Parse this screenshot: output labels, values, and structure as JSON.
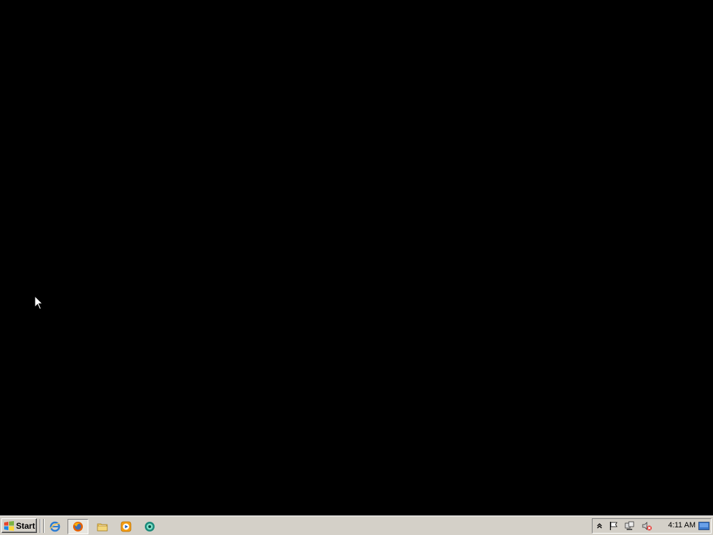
{
  "taskbar": {
    "start_label": "Start",
    "quick_launch": [
      {
        "name": "internet-explorer-icon"
      },
      {
        "name": "firefox-icon"
      },
      {
        "name": "folder-icon"
      },
      {
        "name": "media-player-icon"
      },
      {
        "name": "messenger-icon"
      }
    ],
    "tray": {
      "icons": [
        "show-hidden-icons-chevron",
        "action-center-flag-icon",
        "network-icon",
        "volume-muted-icon"
      ],
      "clock": "4:11 AM"
    }
  },
  "colors": {
    "desktop_background": "#000000",
    "taskbar": "#d4d0c8"
  }
}
